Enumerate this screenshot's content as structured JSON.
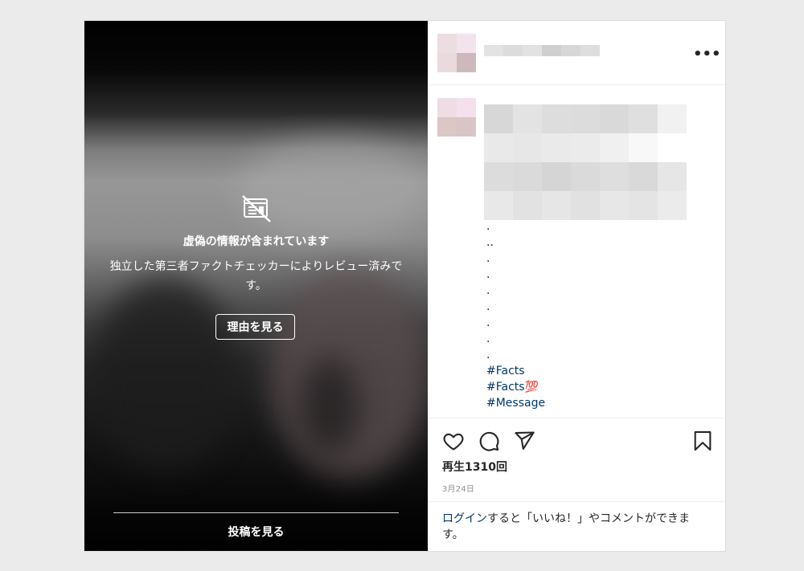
{
  "media": {
    "warning_title": "虚偽の情報が含まれています",
    "warning_description": "独立した第三者ファクトチェッカーによりレビュー済みです。",
    "reason_button": "理由を見る",
    "view_post_button": "投稿を見る",
    "warning_icon": "false-info-icon"
  },
  "header": {
    "more_icon": "more-options-icon",
    "more_glyph": "•••"
  },
  "caption": {
    "dots": [
      ".",
      "..",
      ".",
      ".",
      ".",
      ".",
      ".",
      ".",
      "."
    ],
    "hashtags": [
      "#Facts",
      "#Facts💯",
      "#Message"
    ],
    "tag_color": "#00376b"
  },
  "actions": {
    "like_icon": "heart-icon",
    "comment_icon": "comment-bubble-icon",
    "share_icon": "paper-plane-icon",
    "save_icon": "bookmark-icon"
  },
  "stats": {
    "views": "再生1310回",
    "date": "3月24日"
  },
  "login_prompt": {
    "link": "ログイン",
    "text": "すると「いいね！」やコメントができます。"
  },
  "colors": {
    "link": "#00376b",
    "text": "#262626",
    "muted": "#8e8e8e",
    "border": "#dbdbdb"
  }
}
